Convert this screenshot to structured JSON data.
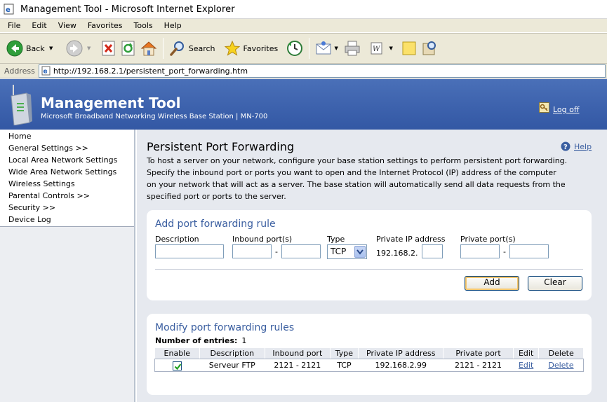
{
  "window": {
    "title": "Management Tool - Microsoft Internet Explorer"
  },
  "menu": [
    "File",
    "Edit",
    "View",
    "Favorites",
    "Tools",
    "Help"
  ],
  "toolbar": {
    "back": "Back",
    "search": "Search",
    "favorites": "Favorites"
  },
  "address": {
    "label": "Address",
    "url": "http://192.168.2.1/persistent_port_forwarding.htm"
  },
  "banner": {
    "title": "Management Tool",
    "subtitle": "Microsoft Broadband Networking Wireless Base Station | MN-700",
    "logoff": "Log off"
  },
  "sidebar": {
    "items": [
      "Home",
      "General Settings >>",
      "Local Area Network Settings",
      "Wide Area Network Settings",
      "Wireless Settings",
      "Parental Controls >>",
      "Security >>",
      "Device Log"
    ]
  },
  "page": {
    "title": "Persistent Port Forwarding",
    "help": "Help",
    "intro": "To host a server on your network, configure your base station settings to perform persistent port forwarding. Specify the inbound port or ports you want to open and the Internet Protocol (IP) address of the computer on your network that will act as a server. The base station will automatically send all data requests from the specified port or ports to the server."
  },
  "add_rule": {
    "title": "Add port forwarding rule",
    "description_label": "Description",
    "inbound_label": "Inbound port(s)",
    "type_label": "Type",
    "type_value": "TCP",
    "private_ip_label": "Private IP address",
    "ip_prefix": "192.168.2.",
    "private_ports_label": "Private port(s)",
    "dash": "-",
    "add_button": "Add",
    "clear_button": "Clear"
  },
  "modify_rules": {
    "title": "Modify port forwarding rules",
    "entries_label": "Number of entries:",
    "entries_count": "1",
    "columns": [
      "Enable",
      "Description",
      "Inbound port",
      "Type",
      "Private IP address",
      "Private port",
      "Edit",
      "Delete"
    ],
    "rows": [
      {
        "enabled": true,
        "description": "Serveur FTP",
        "inbound": "2121 - 2121",
        "type": "TCP",
        "ip": "192.168.2.99",
        "private": "2121 - 2121",
        "edit": "Edit",
        "delete": "Delete"
      }
    ]
  },
  "colors": {
    "banner": "#3d62ad",
    "content_bg": "#e6e9ef",
    "section_title": "#3a5ea0",
    "link": "#3a5ea0",
    "chrome": "#ece9d8"
  }
}
